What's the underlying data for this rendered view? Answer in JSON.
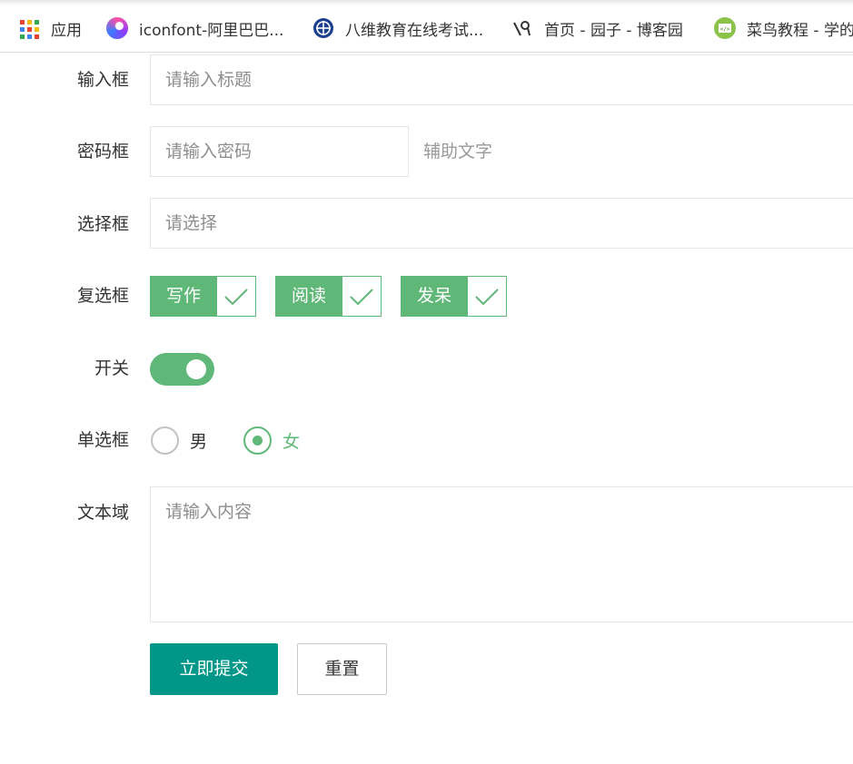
{
  "bookmarks": [
    {
      "label": "应用",
      "icon": "apps-grid-icon"
    },
    {
      "label": "iconfont-阿里巴巴...",
      "icon": "iconfont-logo-icon"
    },
    {
      "label": "八维教育在线考试...",
      "icon": "globe-logo-icon"
    },
    {
      "label": "首页 - 园子 - 博客园",
      "icon": "cnblogs-logo-icon"
    },
    {
      "label": "菜鸟教程 - 学的",
      "icon": "runoob-logo-icon"
    }
  ],
  "form": {
    "title_label": "输入框",
    "title_placeholder": "请输入标题",
    "password_label": "密码框",
    "password_placeholder": "请输入密码",
    "password_aux": "辅助文字",
    "select_label": "选择框",
    "select_placeholder": "请选择",
    "checkbox_label": "复选框",
    "checkboxes": [
      {
        "label": "写作",
        "checked": true
      },
      {
        "label": "阅读",
        "checked": true
      },
      {
        "label": "发呆",
        "checked": true
      }
    ],
    "switch_label": "开关",
    "switch_on": true,
    "radio_label": "单选框",
    "radios": [
      {
        "label": "男",
        "selected": false
      },
      {
        "label": "女",
        "selected": true
      }
    ],
    "textarea_label": "文本域",
    "textarea_placeholder": "请输入内容",
    "submit_label": "立即提交",
    "reset_label": "重置"
  },
  "colors": {
    "checkbox_green": "#5fb878",
    "primary_teal": "#009688",
    "border_gray": "#e6e6e6"
  }
}
